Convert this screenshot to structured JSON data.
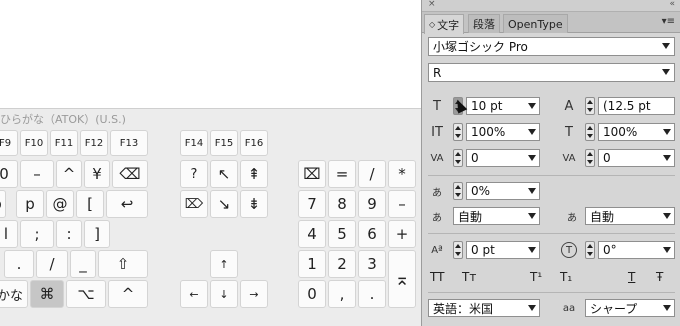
{
  "keyboard": {
    "title": "ひらがな（ATOK）(U.S.)",
    "fn_row_1": [
      "F9",
      "F10",
      "F11",
      "F12",
      "F13"
    ],
    "fn_row_2": [
      "F14",
      "F15",
      "F16"
    ],
    "row_num": [
      "0",
      "–",
      "^",
      "¥",
      "⌫"
    ],
    "row_p": [
      "p",
      "p",
      "@",
      "[",
      "↩"
    ],
    "row_l": [
      "l",
      ";",
      ":",
      "]"
    ],
    "row_dot": [
      ".",
      "/",
      "_",
      "⇧"
    ],
    "row_mod": [
      "かな",
      "⌘",
      "⌥",
      "^"
    ],
    "nav_top": [
      "?",
      "↖",
      "⇞"
    ],
    "nav_mid": [
      "⌦",
      "↘",
      "⇟"
    ],
    "arrow_up": "↑",
    "arrows_bottom": [
      "←",
      "↓",
      "→"
    ],
    "numpad": [
      [
        "⌧",
        "=",
        "/",
        "*"
      ],
      [
        "7",
        "8",
        "9",
        "–"
      ],
      [
        "4",
        "5",
        "6",
        "+"
      ],
      [
        "1",
        "2",
        "3"
      ],
      [
        "0",
        ",",
        "."
      ]
    ],
    "numpad_enter": "⌅"
  },
  "panel": {
    "close_glyph": "×",
    "collapse_glyph": "«",
    "tabs": [
      "文字",
      "段落",
      "OpenType"
    ],
    "tab_arrows": "◇",
    "menu_glyph": "▾≡",
    "font_family": "小塚ゴシック Pro",
    "font_style": "R",
    "font_size": "10 pt",
    "leading": "(12.5 pt",
    "vertical_scale": "100%",
    "horizontal_scale": "100%",
    "kerning": "0",
    "tracking": "0",
    "tsume": "0%",
    "aki_left": "自動",
    "aki_right": "自動",
    "baseline_shift": "0 pt",
    "rotation": "0°",
    "format_buttons": [
      "TT",
      "Tт",
      "T¹",
      "T₁",
      "T",
      "Ŧ"
    ],
    "language": "英語：米国",
    "antialias_icon_label": "aa",
    "antialias": "シャープ",
    "icons": {
      "font_size": "T",
      "leading": "A",
      "vertical_scale": "IT",
      "horizontal_scale": "T",
      "kerning": "VA",
      "tracking": "VA",
      "tsume": "あ",
      "aki_left": "あ",
      "aki_right": "あ",
      "baseline_shift": "Aª",
      "rotation": "T"
    }
  }
}
